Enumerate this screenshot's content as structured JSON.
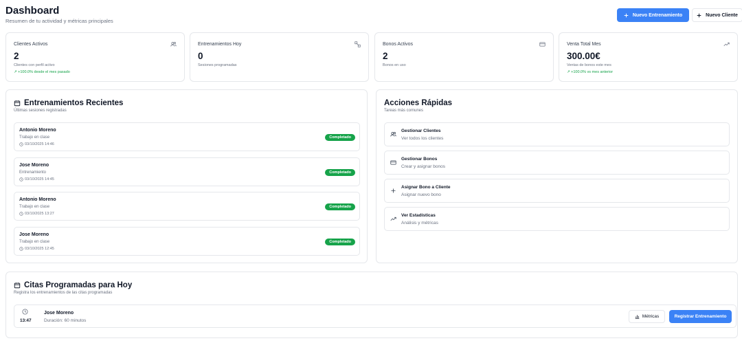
{
  "header": {
    "title": "Dashboard",
    "subtitle": "Resumen de tu actividad y métricas principales",
    "new_training_label": "Nuevo Entrenamiento",
    "new_client_label": "Nuevo Cliente"
  },
  "stats": [
    {
      "label": "Clientes Activos",
      "value": "2",
      "description": "Clientes con perfil activo",
      "trend": "↗ +100.0% desde el mes pasado",
      "icon": "users-icon"
    },
    {
      "label": "Entrenamientos Hoy",
      "value": "0",
      "description": "Sesiones programadas",
      "trend": "",
      "icon": "dumbbell-icon"
    },
    {
      "label": "Bonos Activos",
      "value": "2",
      "description": "Bonos en uso",
      "trend": "",
      "icon": "credit-card-icon"
    },
    {
      "label": "Venta Total Mes",
      "value": "300.00€",
      "description": "Ventas de bonos este mes",
      "trend": "↗ +100.0% vs mes anterior",
      "icon": "trending-up-icon"
    }
  ],
  "recent": {
    "title": "Entrenamientos Recientes",
    "subtitle": "Últimas sesiones registradas",
    "items": [
      {
        "name": "Antonio Moreno",
        "type": "Trabajo en clase",
        "time": "03/10/2025 14:46",
        "status": "Completado"
      },
      {
        "name": "Jose Moreno",
        "type": "Entrenamiento",
        "time": "03/10/2025 14:45",
        "status": "Completado"
      },
      {
        "name": "Antonio Moreno",
        "type": "Trabajo en clase",
        "time": "03/10/2025 13:27",
        "status": "Completado"
      },
      {
        "name": "Jose Moreno",
        "type": "Trabajo en clase",
        "time": "03/10/2025 12:45",
        "status": "Completado"
      }
    ]
  },
  "quick": {
    "title": "Acciones Rápidas",
    "subtitle": "Tareas más comunes",
    "items": [
      {
        "title": "Gestionar Clientes",
        "sub": "Ver todos los clientes",
        "icon": "users-icon"
      },
      {
        "title": "Gestionar Bonos",
        "sub": "Crear y asignar bonos",
        "icon": "credit-card-icon"
      },
      {
        "title": "Asignar Bono a Cliente",
        "sub": "Asignar nuevo bono",
        "icon": "plus-icon"
      },
      {
        "title": "Ver Estadísticas",
        "sub": "Análisis y métricas",
        "icon": "trending-up-icon"
      }
    ]
  },
  "appointments": {
    "title": "Citas Programadas para Hoy",
    "subtitle": "Registra los entrenamientos de las citas programadas",
    "items": [
      {
        "time": "13:47",
        "name": "Jose Moreno",
        "duration": "Duración: 60 minutos",
        "metrics_label": "Métricas",
        "register_label": "Registrar Entrenamiento"
      }
    ]
  },
  "colors": {
    "primary": "#3b82f6",
    "success": "#16a34a",
    "border": "#e5e7eb",
    "muted": "#6b7280"
  }
}
